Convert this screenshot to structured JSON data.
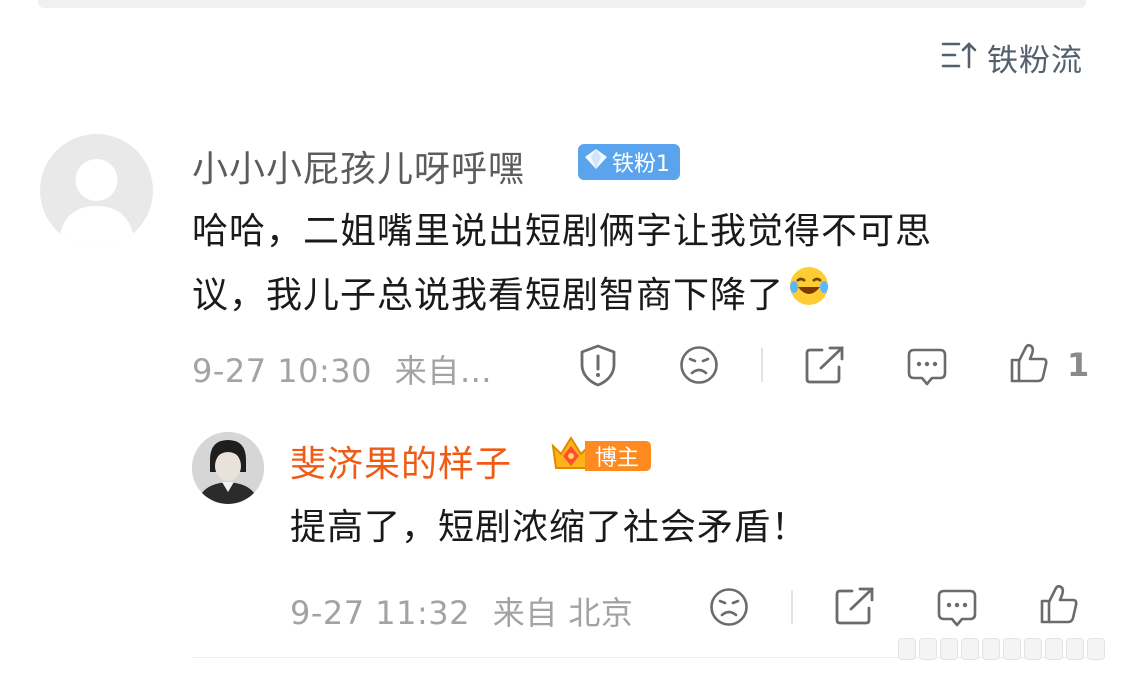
{
  "sort": {
    "label": "铁粉流",
    "icon": "sort-icon"
  },
  "comment": {
    "username": "小小小屁孩儿呀呼嘿",
    "badge": "铁粉1",
    "badge_color": "#5aa4ee",
    "text_line1": "哈哈，二姐嘴里说出短剧俩字让我觉得不可思",
    "text_line2": "议，我儿子总说我看短剧智商下降了",
    "emoji": "laughing-tears-emoji",
    "timestamp": "9-27 10:30",
    "source": "来自…",
    "like_count": "1",
    "actions": [
      "report-icon",
      "dislike-face-icon",
      "share-icon",
      "comment-icon",
      "like-icon"
    ]
  },
  "reply": {
    "username": "斐济果的样子",
    "username_color": "#f05a13",
    "badge": "博主",
    "badge_color": "#ff8a1f",
    "text": "提高了，短剧浓缩了社会矛盾！",
    "timestamp": "9-27 11:32",
    "source": "来自 北京",
    "actions": [
      "dislike-face-icon",
      "share-icon",
      "comment-icon",
      "like-icon"
    ]
  }
}
